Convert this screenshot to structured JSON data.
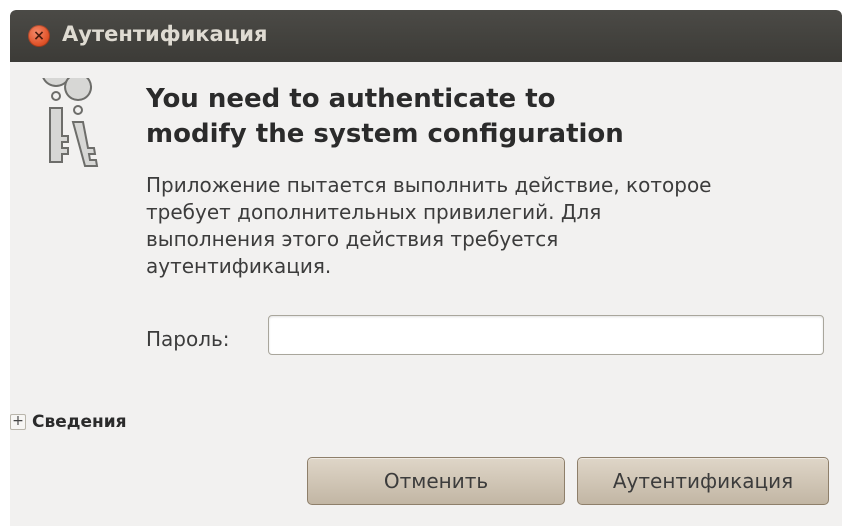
{
  "window": {
    "title": "Аутентификация",
    "close_icon": "close-icon"
  },
  "dialog": {
    "icon": "keys-icon",
    "heading_line1": "You need to authenticate to",
    "heading_line2": "modify the system configuration",
    "message_lines": [
      "Приложение пытается выполнить действие, которое",
      "требует дополнительных привилегий. Для",
      "выполнения этого действия требуется",
      "аутентификация."
    ],
    "password_label": "Пароль:",
    "password_value": "",
    "details_expander": "+",
    "details_label": "Сведения",
    "cancel_label": "Отменить",
    "authenticate_label": "Аутентификация"
  },
  "colors": {
    "titlebar": "#3c3b37",
    "background": "#f2f1f0",
    "close_button": "#e1542a",
    "button": "#c2b6a4"
  }
}
